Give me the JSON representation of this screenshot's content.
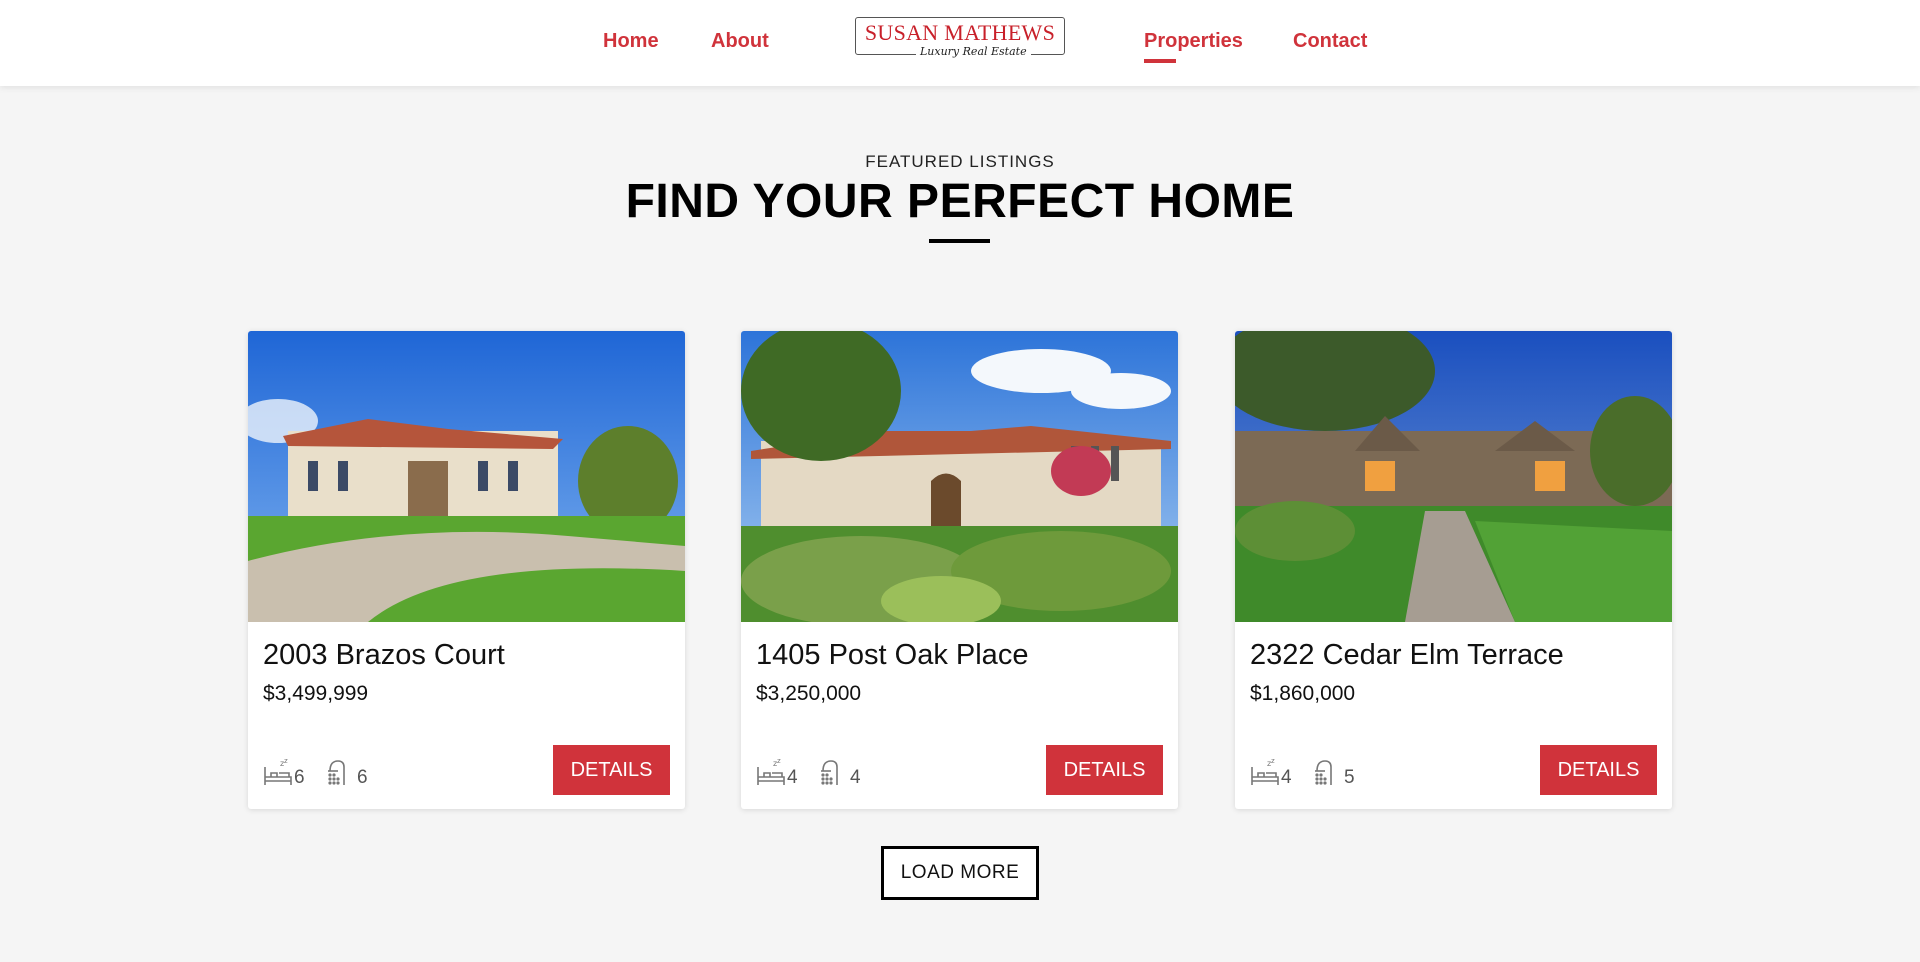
{
  "nav": {
    "home": "Home",
    "about": "About",
    "properties": "Properties",
    "contact": "Contact",
    "active": "properties",
    "accent_color": "#d0333b"
  },
  "logo": {
    "name": "SUSAN MATHEWS",
    "tagline": "Luxury Real Estate"
  },
  "section": {
    "eyebrow": "FEATURED LISTINGS",
    "headline": "FIND YOUR PERFECT HOME"
  },
  "listings": [
    {
      "address": "2003 Brazos Court",
      "price": "$3,499,999",
      "beds": "6",
      "baths": "6",
      "button": "DETAILS",
      "image": "mediterranean-mansion-photo"
    },
    {
      "address": "1405 Post Oak Place",
      "price": "$3,250,000",
      "beds": "4",
      "baths": "4",
      "button": "DETAILS",
      "image": "tuscan-villa-garden-photo"
    },
    {
      "address": "2322 Cedar Elm Terrace",
      "price": "$1,860,000",
      "beds": "4",
      "baths": "5",
      "button": "DETAILS",
      "image": "stone-cottage-driveway-photo"
    }
  ],
  "icons": {
    "beds": "bed-icon",
    "baths": "shower-icon"
  },
  "load_more": "LOAD MORE"
}
